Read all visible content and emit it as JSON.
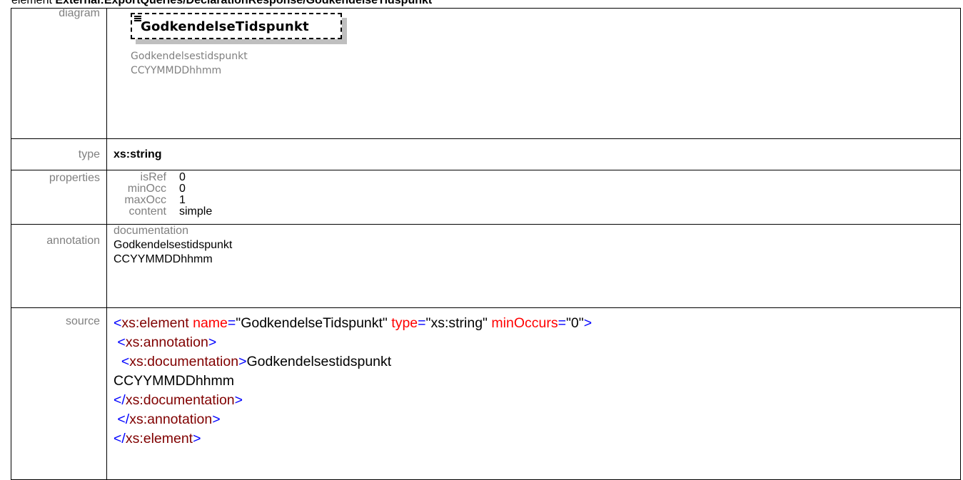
{
  "page": {
    "prefix": "element ",
    "path": "External:ExportQueries/DeclarationResponse/GodkendelseTidspunkt"
  },
  "labels": {
    "diagram": "diagram",
    "type": "type",
    "properties": "properties",
    "annotation": "annotation",
    "source": "source"
  },
  "diagram": {
    "element_name": "GodkendelseTidspunkt",
    "doc_line1": "Godkendelsestidspunkt",
    "doc_line2": "CCYYMMDDhhmm"
  },
  "type": {
    "value": "xs:string"
  },
  "properties": [
    {
      "key": "isRef",
      "value": "0"
    },
    {
      "key": "minOcc",
      "value": "0"
    },
    {
      "key": "maxOcc",
      "value": "1"
    },
    {
      "key": "content",
      "value": "simple"
    }
  ],
  "annotation": {
    "heading": "documentation",
    "line1": "Godkendelsestidspunkt",
    "line2": "CCYYMMDDhhmm"
  },
  "source": {
    "open_bracket": "<",
    "close_bracket": ">",
    "end_open": "</",
    "element_tag": "xs:element",
    "attr_name": "name",
    "eq": "=",
    "name_value": "\"GodkendelseTidspunkt\"",
    "attr_type": "type",
    "type_value": "\"xs:string\"",
    "attr_minOccurs": "minOccurs",
    "minOccurs_value": "\"0\"",
    "annotation_tag": "xs:annotation",
    "documentation_tag": "xs:documentation",
    "doc_text1": "Godkendelsestidspunkt",
    "doc_text2": "CCYYMMDDhhmm"
  },
  "colors": {
    "tag": "#800000",
    "attribute": "#ff0000",
    "bracket": "#0000ff",
    "label_gray": "#808080"
  }
}
